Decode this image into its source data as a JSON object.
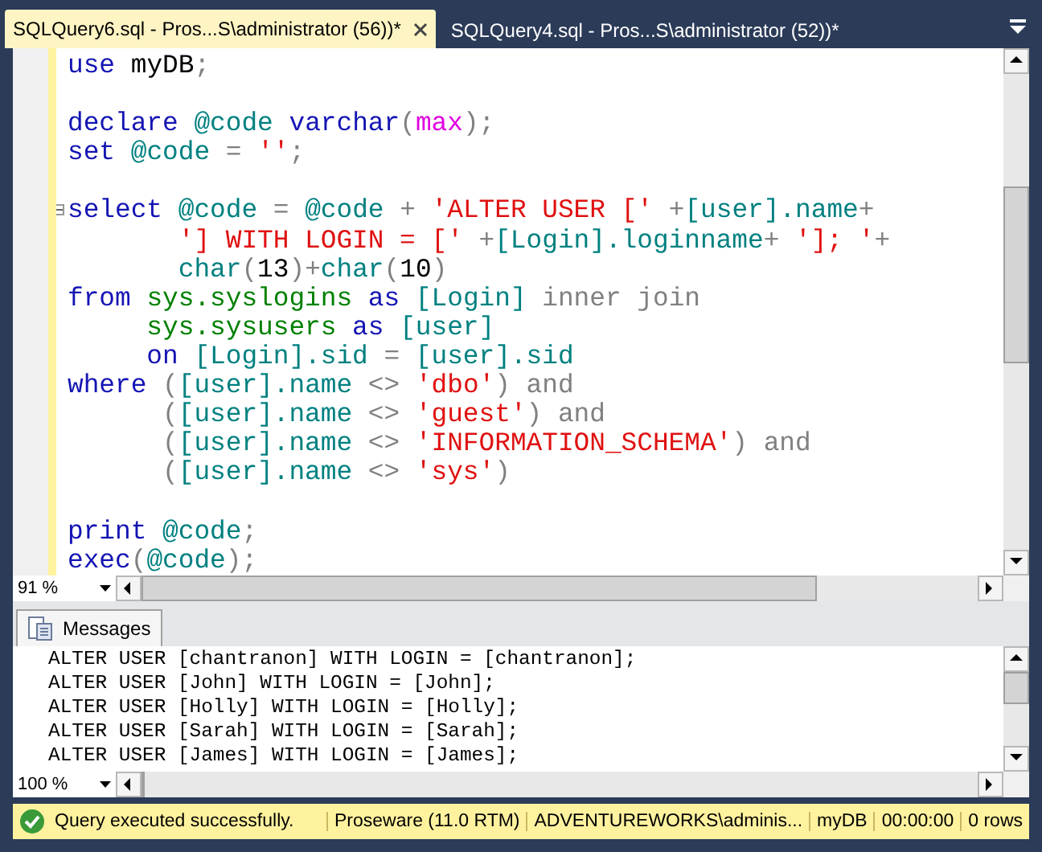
{
  "tabs": [
    {
      "label": "SQLQuery6.sql - Pros...S\\administrator (56))*",
      "selected": true
    },
    {
      "label": "SQLQuery4.sql - Pros...S\\administrator (52))*",
      "selected": false
    }
  ],
  "editor": {
    "zoom": "91 %",
    "lines": [
      {
        "tokens": [
          {
            "kind": "keyword",
            "t": "use"
          },
          {
            "kind": "plain",
            "t": " myDB"
          },
          {
            "kind": "operator",
            "t": ";"
          }
        ]
      },
      {
        "blank_before": true,
        "tokens": [
          {
            "kind": "keyword",
            "t": "declare"
          },
          {
            "kind": "variable",
            "t": " @code"
          },
          {
            "kind": "keyword",
            "t": " varchar"
          },
          {
            "kind": "operator",
            "t": "("
          },
          {
            "kind": "function",
            "t": "max"
          },
          {
            "kind": "operator",
            "t": ");"
          }
        ]
      },
      {
        "tokens": [
          {
            "kind": "keyword",
            "t": "set"
          },
          {
            "kind": "variable",
            "t": " @code"
          },
          {
            "kind": "operator",
            "t": " = "
          },
          {
            "kind": "string",
            "t": "''"
          },
          {
            "kind": "operator",
            "t": ";"
          }
        ]
      },
      {
        "blank_before": true,
        "fold": true,
        "tokens": [
          {
            "kind": "keyword",
            "t": "select"
          },
          {
            "kind": "variable",
            "t": " @code"
          },
          {
            "kind": "operator",
            "t": " = "
          },
          {
            "kind": "variable",
            "t": "@code"
          },
          {
            "kind": "operator",
            "t": " + "
          },
          {
            "kind": "string",
            "t": "'ALTER USER ['"
          },
          {
            "kind": "operator",
            "t": " +"
          },
          {
            "kind": "variable",
            "t": "[user].name"
          },
          {
            "kind": "operator",
            "t": "+"
          }
        ]
      },
      {
        "tokens": [
          {
            "kind": "string",
            "t": "       '] WITH LOGIN = ['"
          },
          {
            "kind": "operator",
            "t": " +"
          },
          {
            "kind": "variable",
            "t": "[Login].loginname"
          },
          {
            "kind": "operator",
            "t": "+ "
          },
          {
            "kind": "string",
            "t": "']; '"
          },
          {
            "kind": "operator",
            "t": "+"
          }
        ]
      },
      {
        "tokens": [
          {
            "kind": "variable",
            "t": "       char"
          },
          {
            "kind": "operator",
            "t": "("
          },
          {
            "kind": "plain",
            "t": "13"
          },
          {
            "kind": "operator",
            "t": ")+"
          },
          {
            "kind": "variable",
            "t": "char"
          },
          {
            "kind": "operator",
            "t": "("
          },
          {
            "kind": "plain",
            "t": "10"
          },
          {
            "kind": "operator",
            "t": ")"
          }
        ]
      },
      {
        "tokens": [
          {
            "kind": "keyword",
            "t": "from"
          },
          {
            "kind": "system",
            "t": " sys.syslogins"
          },
          {
            "kind": "keyword",
            "t": " as"
          },
          {
            "kind": "variable",
            "t": " [Login]"
          },
          {
            "kind": "operator",
            "t": " inner join"
          }
        ]
      },
      {
        "tokens": [
          {
            "kind": "system",
            "t": "     sys.sysusers"
          },
          {
            "kind": "keyword",
            "t": " as"
          },
          {
            "kind": "variable",
            "t": " [user]"
          }
        ]
      },
      {
        "tokens": [
          {
            "kind": "keyword",
            "t": "     on"
          },
          {
            "kind": "variable",
            "t": " [Login].sid"
          },
          {
            "kind": "operator",
            "t": " = "
          },
          {
            "kind": "variable",
            "t": "[user].sid"
          }
        ]
      },
      {
        "tokens": [
          {
            "kind": "keyword",
            "t": "where"
          },
          {
            "kind": "operator",
            "t": " ("
          },
          {
            "kind": "variable",
            "t": "[user].name"
          },
          {
            "kind": "operator",
            "t": " <> "
          },
          {
            "kind": "string",
            "t": "'dbo'"
          },
          {
            "kind": "operator",
            "t": ") and"
          }
        ]
      },
      {
        "tokens": [
          {
            "kind": "operator",
            "t": "      ("
          },
          {
            "kind": "variable",
            "t": "[user].name"
          },
          {
            "kind": "operator",
            "t": " <> "
          },
          {
            "kind": "string",
            "t": "'guest'"
          },
          {
            "kind": "operator",
            "t": ") and"
          }
        ]
      },
      {
        "tokens": [
          {
            "kind": "operator",
            "t": "      ("
          },
          {
            "kind": "variable",
            "t": "[user].name"
          },
          {
            "kind": "operator",
            "t": " <> "
          },
          {
            "kind": "string",
            "t": "'INFORMATION_SCHEMA'"
          },
          {
            "kind": "operator",
            "t": ") and"
          }
        ]
      },
      {
        "tokens": [
          {
            "kind": "operator",
            "t": "      ("
          },
          {
            "kind": "variable",
            "t": "[user].name"
          },
          {
            "kind": "operator",
            "t": " <> "
          },
          {
            "kind": "string",
            "t": "'sys'"
          },
          {
            "kind": "operator",
            "t": ")"
          }
        ]
      },
      {
        "blank_before": true,
        "tokens": [
          {
            "kind": "keyword",
            "t": "print"
          },
          {
            "kind": "variable",
            "t": " @code"
          },
          {
            "kind": "operator",
            "t": ";"
          }
        ]
      },
      {
        "tokens": [
          {
            "kind": "keyword",
            "t": "exec"
          },
          {
            "kind": "operator",
            "t": "("
          },
          {
            "kind": "variable",
            "t": "@code"
          },
          {
            "kind": "operator",
            "t": ");"
          }
        ]
      }
    ]
  },
  "messages": {
    "tab": "Messages",
    "zoom": "100 %",
    "lines": [
      "ALTER USER [chantranon] WITH LOGIN = [chantranon];",
      "ALTER USER [John] WITH LOGIN = [John];",
      "ALTER USER [Holly] WITH LOGIN = [Holly];",
      "ALTER USER [Sarah] WITH LOGIN = [Sarah];",
      "ALTER USER [James] WITH LOGIN = [James];"
    ]
  },
  "status": {
    "message": "Query executed successfully.",
    "items": [
      "Proseware (11.0 RTM)",
      "ADVENTUREWORKS\\adminis...",
      "myDB",
      "00:00:00",
      "0 rows"
    ]
  }
}
